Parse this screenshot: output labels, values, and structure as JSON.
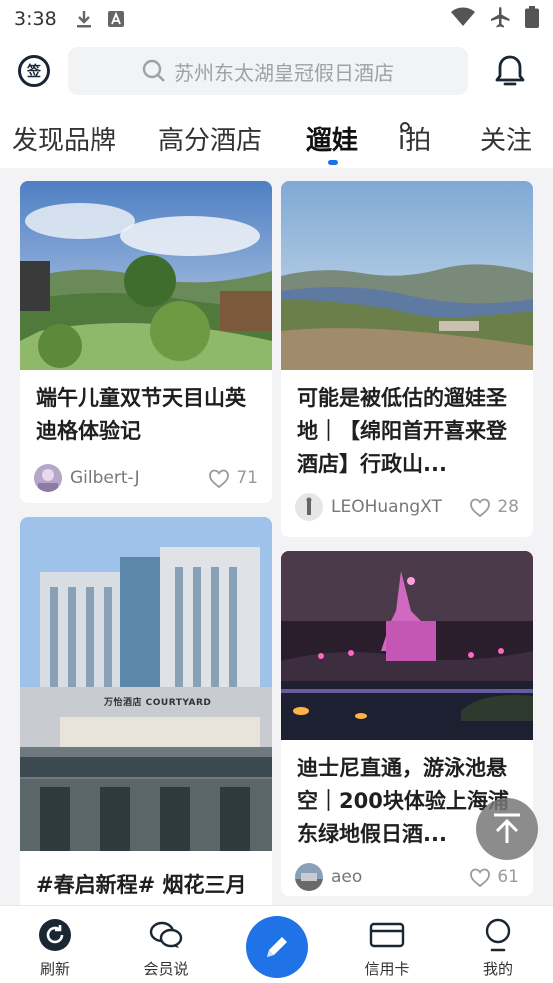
{
  "status_bar": {
    "time": "3:38"
  },
  "header": {
    "checkin_label": "签",
    "search_placeholder": "苏州东太湖皇冠假日酒店"
  },
  "tabs": [
    {
      "label": "发现品牌"
    },
    {
      "label": "高分酒店"
    },
    {
      "label": "遛娃"
    },
    {
      "label": "i拍"
    },
    {
      "label": "关注"
    }
  ],
  "active_tab": "遛娃",
  "feed": {
    "left": [
      {
        "title": "端午儿童双节天目山英迪格体验记",
        "user": "Gilbert-J",
        "likes": "71"
      },
      {
        "title": "#春启新程# 烟花三月",
        "user": "",
        "likes": ""
      }
    ],
    "right": [
      {
        "title": "可能是被低估的遛娃圣地｜【绵阳首开喜来登酒店】行政山...",
        "user": "LEOHuangXT",
        "likes": "28"
      },
      {
        "title": "迪士尼直通，游泳池悬空｜200块体验上海浦东绿地假日酒...",
        "user": "aeo",
        "likes": "61"
      }
    ]
  },
  "hotel_sign": "万怡酒店 COURTYARD",
  "bottom_nav": [
    {
      "label": "刷新",
      "icon": "refresh-icon"
    },
    {
      "label": "会员说",
      "icon": "chat-bubbles-icon"
    },
    {
      "label": "",
      "icon": "pencil-icon"
    },
    {
      "label": "信用卡",
      "icon": "credit-card-icon"
    },
    {
      "label": "我的",
      "icon": "person-icon"
    }
  ],
  "colors": {
    "accent": "#1f73e6",
    "text": "#1f1f1f"
  }
}
